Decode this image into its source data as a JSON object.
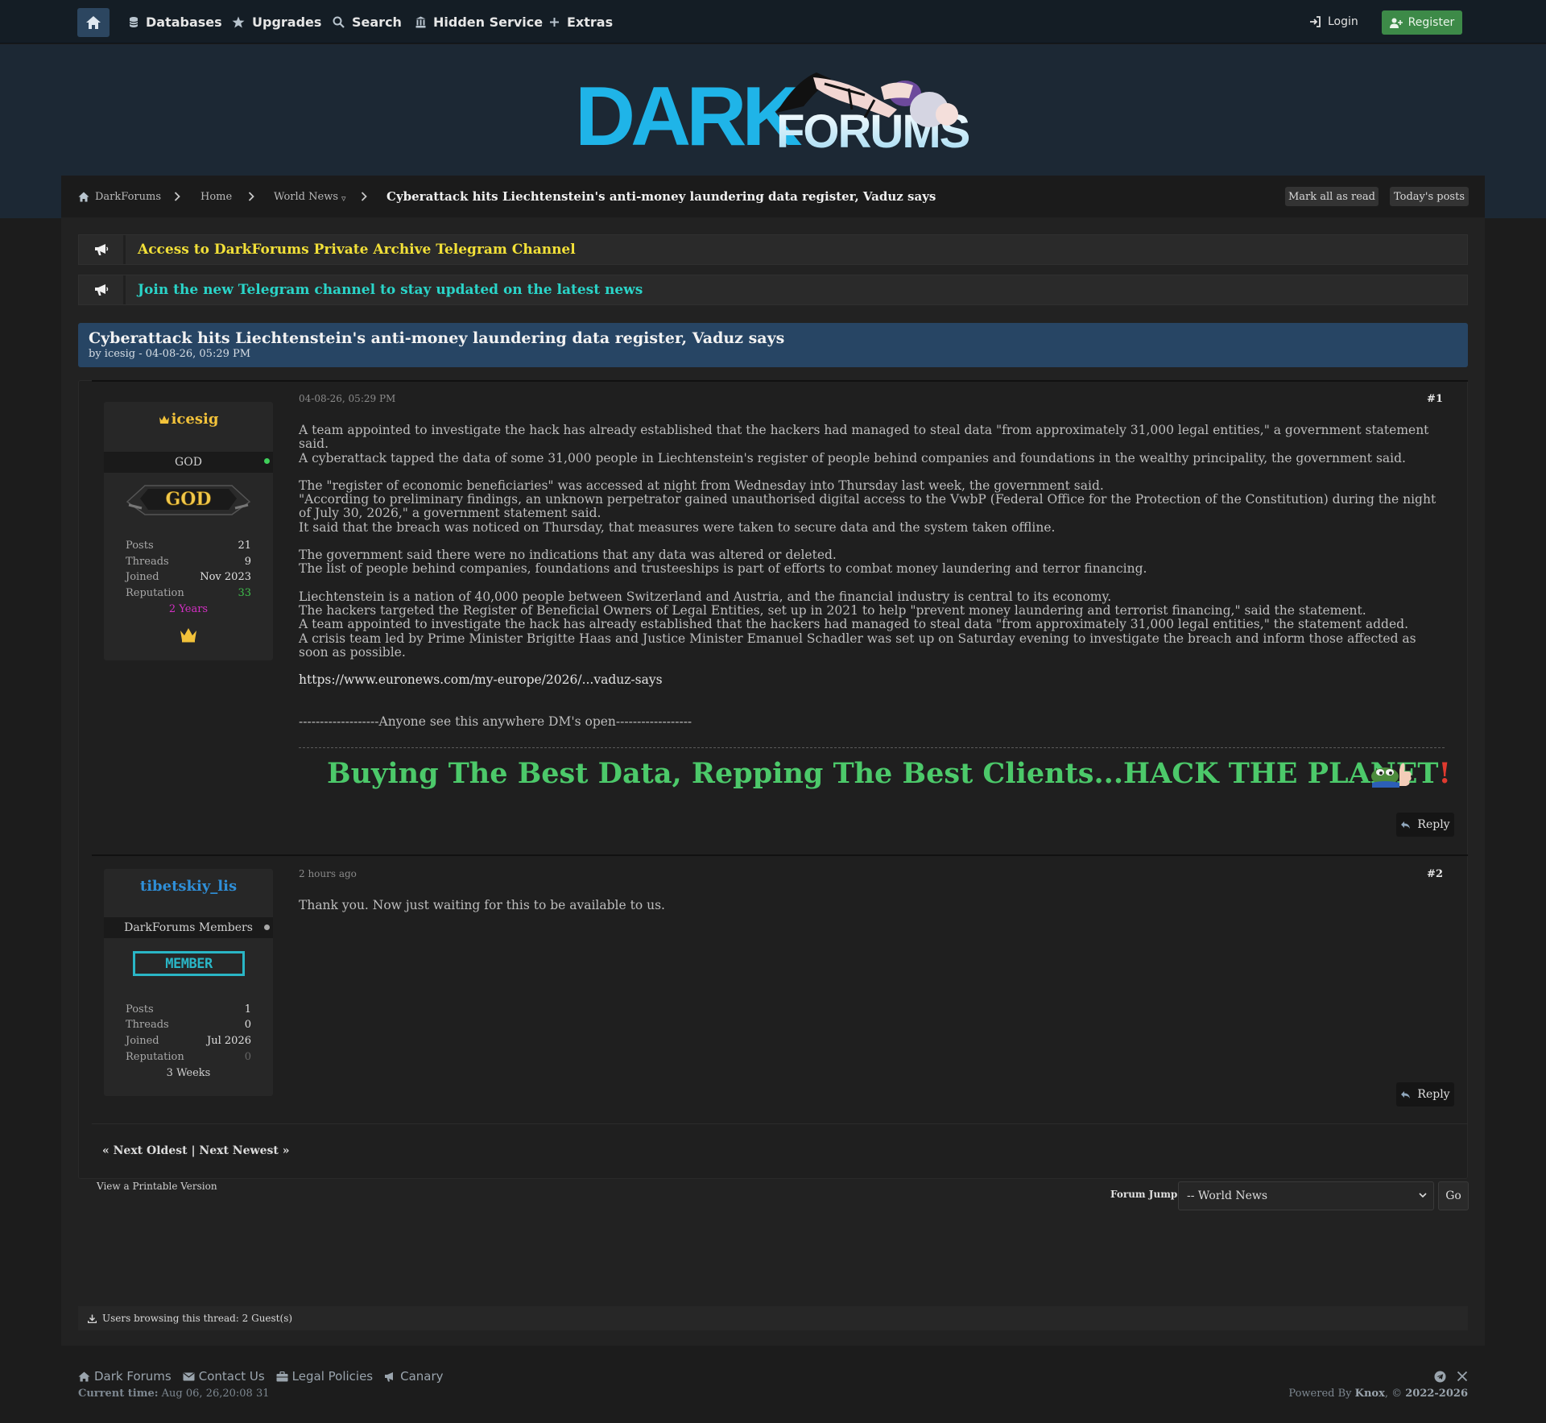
{
  "nav": {
    "databases": "Databases",
    "upgrades": "Upgrades",
    "search": "Search",
    "hidden_service": "Hidden Service",
    "extras": "Extras",
    "login": "Login",
    "register": "Register"
  },
  "logo": {
    "line1": "DARK",
    "line2": "FORUMS"
  },
  "breadcrumb": {
    "items": [
      "DarkForums",
      "Home",
      "World News",
      "Cyberattack hits Liechtenstein's anti-money laundering data register, Vaduz says"
    ],
    "dropdown_mark": "▿",
    "mark_all_read": "Mark all as read",
    "todays_posts": "Today's posts"
  },
  "announcements": [
    {
      "text": "Access to DarkForums Private Archive Telegram Channel",
      "color": "#f2e038"
    },
    {
      "text": "Join the new Telegram channel to stay updated on the latest news",
      "color": "#2ad4c8"
    }
  ],
  "thread": {
    "title": "Cyberattack hits Liechtenstein's anti-money laundering data register, Vaduz says",
    "byline": "by icesig - 04-08-26, 05:29 PM"
  },
  "posts": [
    {
      "author": "icesig",
      "author_color": "#f2c23a",
      "role": "GOD",
      "badge": "GOD",
      "online": true,
      "stats": {
        "posts_label": "Posts",
        "posts": "21",
        "threads_label": "Threads",
        "threads": "9",
        "joined_label": "Joined",
        "joined": "Nov 2023",
        "reputation_label": "Reputation",
        "reputation": "33"
      },
      "tenure": "2 Years",
      "date": "04-08-26, 05:29 PM",
      "number": "#1",
      "body": [
        "A team appointed to investigate the hack has already established that the hackers had managed to steal data \"from approximately 31,000 legal entities,\" a government statement said.",
        "A cyberattack tapped the data of some 31,000 people in Liechtenstein's register of people behind companies and foundations in the wealthy principality, the government said.",
        "",
        "The \"register of economic beneficiaries\" was accessed at night from Wednesday into Thursday last week, the government said.",
        "\"According to preliminary findings, an unknown perpetrator gained unauthorised digital access to the VwbP (Federal Office for the Protection of the Constitution) during the night of July 30, 2026,\" a government statement said.",
        "It said that the breach was noticed on Thursday, that measures were taken to secure data and the system taken offline.",
        "",
        "The government said there were no indications that any data was altered or deleted.",
        "The list of people behind companies, foundations and trusteeships is part of efforts to combat money laundering and terror financing.",
        "",
        "Liechtenstein is a nation of 40,000 people between Switzerland and Austria, and the financial industry is central to its economy.",
        "The hackers targeted the Register of Beneficial Owners of Legal Entities, set up in 2021 to help \"prevent money laundering and terrorist financing,\" said the statement.",
        "A team appointed to investigate the hack has already established that the hackers had managed to steal data \"from approximately 31,000 legal entities,\" the statement added.",
        "A crisis team led by Prime Minister Brigitte Haas and Justice Minister Emanuel Schadler was set up on Saturday evening to investigate the breach and inform those affected as soon as possible."
      ],
      "link": "https://www.euronews.com/my-europe/2026/...vaduz-says",
      "note": "-------------------Anyone see this anywhere DM's open------------------",
      "signature": "Buying The Best Data, Repping The Best Clients...HACK THE PLANET",
      "signature_bang": "!",
      "reply": "Reply"
    },
    {
      "author": "tibetskiy_lis",
      "author_color": "#2f8fd8",
      "role": "DarkForums Members",
      "badge": "MEMBER",
      "online": false,
      "stats": {
        "posts_label": "Posts",
        "posts": "1",
        "threads_label": "Threads",
        "threads": "0",
        "joined_label": "Joined",
        "joined": "Jul 2026",
        "reputation_label": "Reputation",
        "reputation": "0"
      },
      "tenure": "3 Weeks",
      "date": "2 hours ago",
      "number": "#2",
      "body": [
        "Thank you. Now just waiting for this to be available to us."
      ],
      "reply": "Reply"
    }
  ],
  "pagination": {
    "text": "« Next Oldest | Next Newest »"
  },
  "footer_tools": {
    "printable": "View a Printable Version",
    "forum_jump_label": "Forum Jump:",
    "forum_jump_value": "-- World News",
    "go": "Go"
  },
  "browsing": "Users browsing this thread: 2 Guest(s)",
  "footer": {
    "links": [
      "Dark Forums",
      "Contact Us",
      "Legal Policies",
      "Canary"
    ],
    "current_time_label": "Current time:",
    "current_time": "Aug 06, 26,20:08 31",
    "powered_prefix": "Powered By",
    "powered_name": "Knox",
    "copyright": ", ©",
    "years": "2022-2026"
  }
}
